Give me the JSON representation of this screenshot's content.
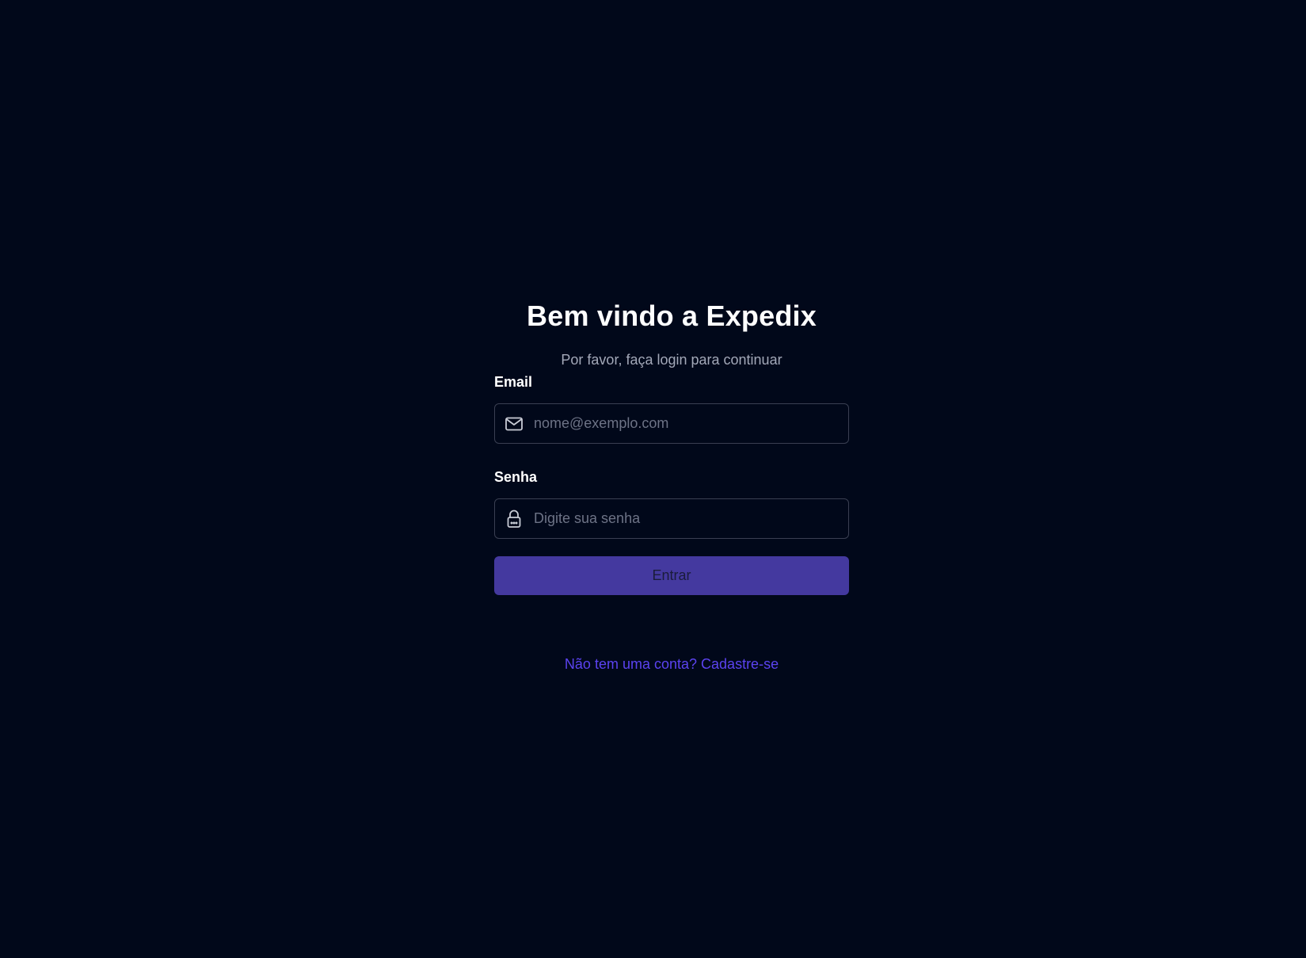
{
  "header": {
    "title": "Bem vindo a Expedix",
    "subtitle": "Por favor, faça login para continuar"
  },
  "form": {
    "email": {
      "label": "Email",
      "placeholder": "nome@exemplo.com",
      "value": "",
      "icon": "mail-icon"
    },
    "password": {
      "label": "Senha",
      "placeholder": "Digite sua senha",
      "value": "",
      "icon": "lock-icon"
    },
    "submit_label": "Entrar"
  },
  "footer": {
    "prompt": "Não tem uma conta?",
    "link_label": "Cadastre-se"
  },
  "colors": {
    "background": "#01081a",
    "accent": "#44399f",
    "link": "#5b43f0",
    "input_border": "#3a3f52"
  }
}
